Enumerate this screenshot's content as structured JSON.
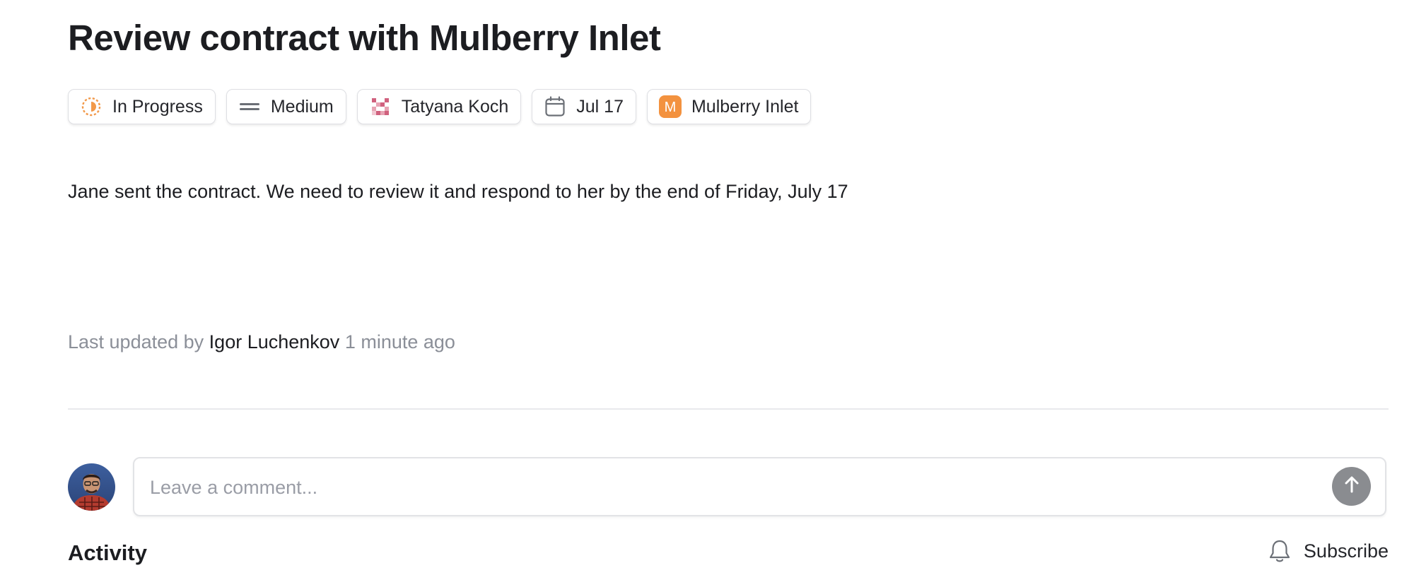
{
  "issue": {
    "title": "Review contract with Mulberry Inlet",
    "description": "Jane sent the contract. We need to review it and respond to her by the end of Friday, July 17"
  },
  "properties": {
    "status": {
      "label": "In Progress",
      "icon": "in-progress-icon",
      "color": "#f2994a"
    },
    "priority": {
      "label": "Medium",
      "icon": "priority-medium-icon"
    },
    "assignee": {
      "label": "Tatyana Koch",
      "icon": "user-avatar-icon",
      "color": "#d0617e"
    },
    "due_date": {
      "label": "Jul 17",
      "icon": "calendar-icon"
    },
    "project": {
      "label": "Mulberry Inlet",
      "icon": "project-icon",
      "initial": "M",
      "color": "#f3923f"
    }
  },
  "meta": {
    "updated_prefix": "Last updated by",
    "updated_by": "Igor Luchenkov",
    "updated_time": "1 minute ago"
  },
  "comment": {
    "placeholder": "Leave a comment...",
    "send_icon": "arrow-up-icon",
    "avatar": "current-user-avatar"
  },
  "activity": {
    "heading": "Activity",
    "subscribe_label": "Subscribe",
    "subscribe_icon": "bell-icon"
  }
}
